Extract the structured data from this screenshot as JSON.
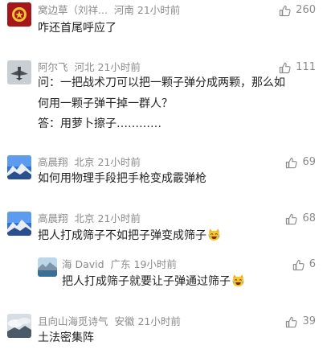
{
  "comments": [
    {
      "user": "窝边草（刘祥...",
      "location": "河南",
      "time": "21小时前",
      "likes": "260",
      "lines": [
        "咋还首尾呼应了"
      ],
      "avatar": "emblem-avatar"
    },
    {
      "user": "阿尔飞",
      "location": "河北",
      "time": "21小时前",
      "likes": "111",
      "lines": [
        "问：一把战术刀可以把一颗子弹分成两颗，那么如",
        "何用一颗子弹干掉一群人？",
        "答：用萝卜擦子…………"
      ],
      "avatar": "jet-avatar"
    },
    {
      "user": "高晨翔",
      "location": "北京",
      "time": "21小时前",
      "likes": "69",
      "lines": [
        "如何用物理手段把手枪变成霰弹枪"
      ],
      "avatar": "mountain-avatar"
    },
    {
      "user": "高晨翔",
      "location": "北京",
      "time": "21小时前",
      "likes": "68",
      "lines": [
        "把人打成筛子不如把子弹变成筛子"
      ],
      "avatar": "mountain-avatar"
    },
    {
      "user": "海 David",
      "location": "广东",
      "time": "19小时前",
      "likes": "6",
      "lines": [
        "把人打成筛子就要让子弹通过筛子"
      ],
      "avatar": "lake-avatar"
    },
    {
      "user": "且向山海觅诗气",
      "location": "安徽",
      "time": "21小时前",
      "likes": "39",
      "lines": [
        "土法密集阵"
      ],
      "avatar": "cloud-avatar"
    }
  ],
  "colors": {
    "meta": "#8a8a8a",
    "text": "#222222"
  }
}
